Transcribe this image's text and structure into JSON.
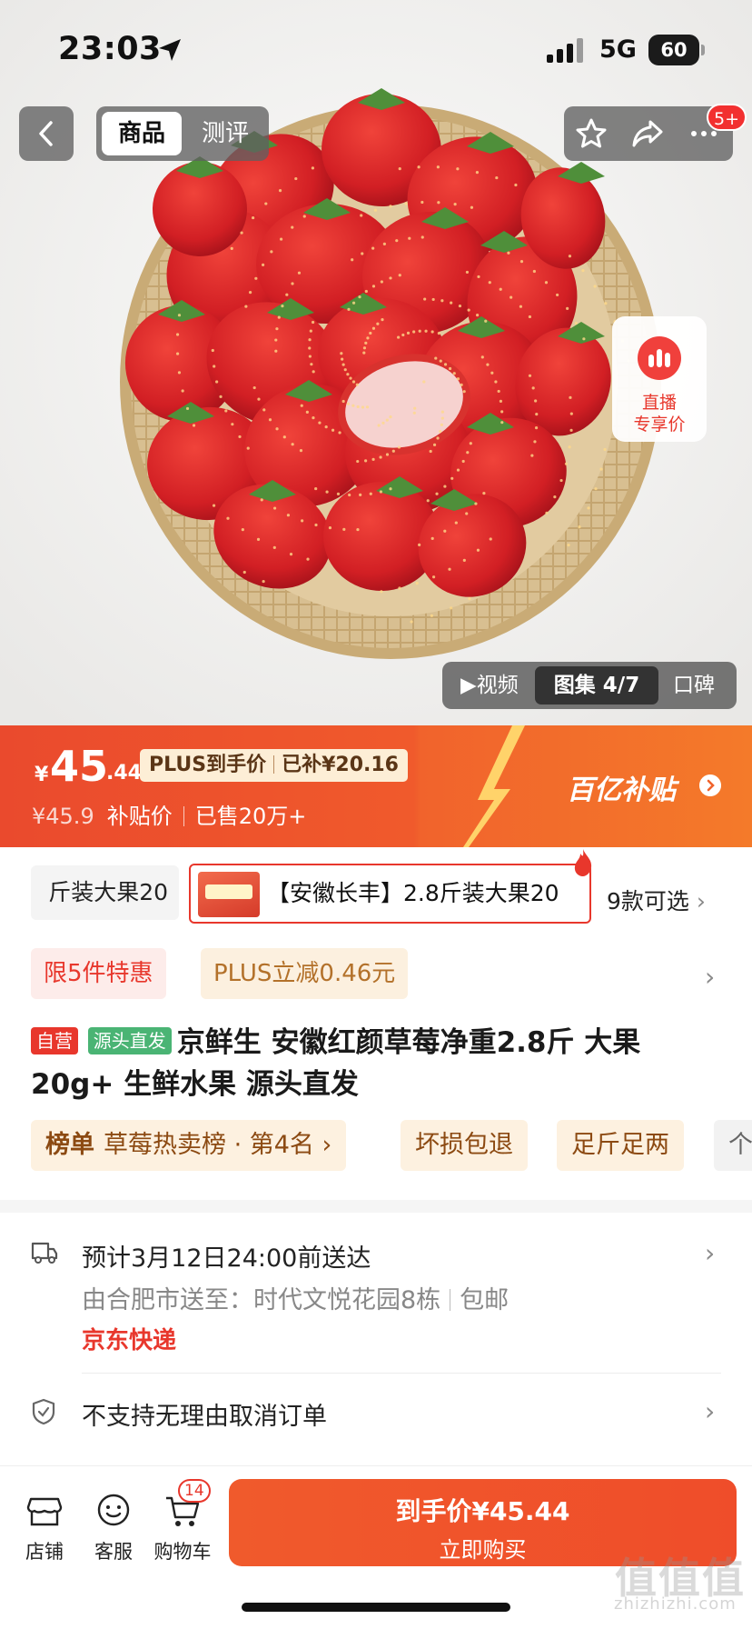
{
  "status_bar": {
    "time": "23:03",
    "network": "5G",
    "battery": "60"
  },
  "nav": {
    "tabs": [
      {
        "label": "商品",
        "active": true
      },
      {
        "label": "测评",
        "active": false
      }
    ],
    "message_badge": "5+"
  },
  "live_card": {
    "line1": "直播",
    "line2": "专享价"
  },
  "gallery": {
    "video_label": "▶视频",
    "album_label": "图集 4/7",
    "review_label": "口碑"
  },
  "price": {
    "yen": "¥",
    "amount": "45",
    "decimal": ".44",
    "plus_label": "PLUS到手价",
    "subsidy_amount": "已补¥20.16",
    "original_price": "¥45.9",
    "subsidy_price_label": "补贴价",
    "sold": "已售20万+",
    "subsidy_logo": "百亿补贴"
  },
  "specs": {
    "left_partial": "斤装大果20",
    "selected": "【安徽长丰】2.8斤装大果20",
    "more": "9款可选"
  },
  "promotions": [
    "限5件特惠",
    "PLUS立减0.46元"
  ],
  "product": {
    "tag_self": "自营",
    "tag_source": "源头直发",
    "title": "京鲜生 安徽红颜草莓净重2.8斤 大果20g+ 生鲜水果 源头直发"
  },
  "ranking": {
    "label": "榜单",
    "text": "草莓热卖榜 · 第4名"
  },
  "promises": [
    "坏损包退",
    "足斤足两",
    "个"
  ],
  "delivery": {
    "eta": "预计3月12日24:00前送达",
    "from_to": "由合肥市送至：时代文悦花园8栋",
    "shipping": "包邮",
    "carrier": "京东快递"
  },
  "service": {
    "cancel_policy": "不支持无理由取消订单"
  },
  "bottom_bar": {
    "store": "店铺",
    "service": "客服",
    "cart": "购物车",
    "cart_count": "14",
    "buy_price": "到手价¥45.44",
    "buy_label": "立即购买"
  },
  "watermark": {
    "text": "值值值",
    "site": "zhizhizhi.com"
  },
  "colors": {
    "accent": "#e8372c",
    "banner_orange": "#f05a2c",
    "plus_gold": "#b3712a",
    "source_green": "#4ab474"
  }
}
